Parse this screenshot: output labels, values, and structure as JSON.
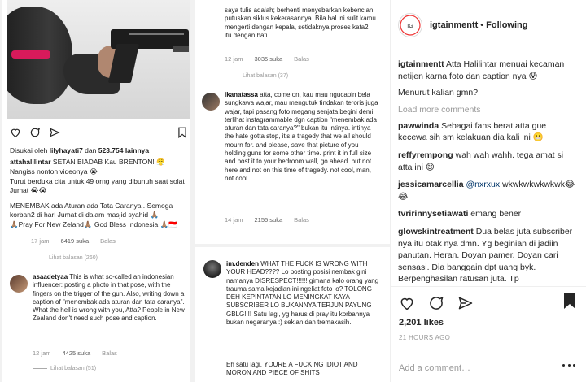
{
  "post": {
    "panel_left": {
      "liked_by_prefix": "Disukai oleh",
      "liked_by_user": "lilyhayati7",
      "liked_by_and": "dan",
      "liked_by_count": "523.754 lainnya",
      "caption_user": "attahalilintar",
      "caption_lines": [
        "SETAN BIADAB Kau BRENTON! 😤",
        "Nangiss nonton videonya 😭",
        "Turut berduka cita untuk 49 orng yang dibunuh saat solat Jumat 😭😭",
        "MENEMBAK ada Aturan ada Tata Caranya.. Semoga korban2 di hari Jumat di dalam masjid syahid 🙏🏽",
        "🙏🏽Pray For New Zeland🙏🏽 God Bless Indonesia 🙏🏽🇮🇩"
      ],
      "caption_meta": {
        "time": "17 jam",
        "likes": "6419 suka",
        "reply": "Balas"
      },
      "caption_replies": "Lihat balasan (260)",
      "comment1": {
        "user": "asaadetyaa",
        "text": "This is what so-called an indonesian influencer: posting a photo in that pose, with the fingers on the trigger of the gun. Also, writing down a caption of \"menembak ada aturan dan tata caranya\". What the hell is wrong with you, Atta? People in New Zealand don't need such pose and caption.",
        "time": "12 jam",
        "likes": "4425 suka",
        "reply": "Balas",
        "replies": "Lihat balasan (51)"
      }
    },
    "panel_mid": {
      "text": "saya tulis adalah; berhenti menyebarkan kebencian, putuskan siklus kekerasannya. Bila hal ini sulit kamu mengerti dengan kepala, setidaknya proses kata2 itu dengan hati.",
      "time": "12 jam",
      "likes": "3035 suka",
      "reply": "Balas",
      "replies": "Lihat balasan (37)",
      "comment": {
        "user": "ikanatassa",
        "text": "atta, come on, kau mau ngucapin bela sungkawa wajar, mau mengutuk tindakan teroris juga wajar, tapi pasang foto megang senjata begini demi terlihat instagrammable dgn caption \"menembak ada aturan dan tata caranya?\" bukan itu intinya. intinya the hate gotta stop, it's a tragedy that we all should mourn for. and please, save that picture of you holding guns for some other time. print it in full size and post it to your bedroom wall, go ahead. but not here and not on this time of tragedy. not cool, man, not cool.",
        "time": "14 jam",
        "likes": "2155 suka",
        "reply": "Balas"
      }
    },
    "panel_bottom": {
      "user": "im.denden",
      "text": "WHAT THE FUCK IS WRONG WITH YOUR HEAD???? Lo posting posisi nembak gini namanya DISRESPECT!!!!!! gimana kalo orang yang trauma sama kejadian ini ngeliat foto lo? TOLONG DEH KEPINTATAN LO MENINGKAT KAYA SUBSCRIBER LO BUKANNYA TERJUN PAYUNG GBLG!!!! Satu lagi, yg harus di pray itu korbannya bukan negaranya :) sekian dan tremakasih.",
      "text2": "Eh satu lagi. YOURE A FUCKING IDIOT AND MORON AND PIECE OF SHITS"
    }
  },
  "sidebar": {
    "account": "igtainmentt",
    "follow_status": "Following",
    "caption": {
      "user": "igtainmentt",
      "text": "Atta Halilintar menuai kecaman netijen karna foto dan caption nya 😰",
      "text2": "Menurut kalian gmn?"
    },
    "load_more": "Load more comments",
    "comments": [
      {
        "user": "pawwinda",
        "text": "Sebagai fans berat atta gue kecewa sih sm kelakuan dia kali ini 😬"
      },
      {
        "user": "reffyrempong",
        "text": "wah wah wahh. tega amat si atta ini 😊"
      },
      {
        "user": "jessicamarcellia",
        "mention": "@nxrxux",
        "text": "wkwkwkwkwkwk😂😂"
      },
      {
        "user": "tvririnnysetiawati",
        "text": "emang bener"
      },
      {
        "user": "glowskintreatment",
        "text": "Dua belas juta subscriber nya itu otak nya dmn. Yg beginian di jadiin panutan. Heran. Doyan pamer. Doyan cari sensasi. Dia banggain dpt uang byk. Berpenghasilan ratusan juta. Tp"
      }
    ],
    "likes": "2,201 likes",
    "time": "21 HOURS AGO",
    "add_comment_placeholder": "Add a comment…",
    "icons": [
      "heart-icon",
      "comment-icon",
      "share-icon",
      "bookmark-icon",
      "more-options-icon"
    ]
  }
}
